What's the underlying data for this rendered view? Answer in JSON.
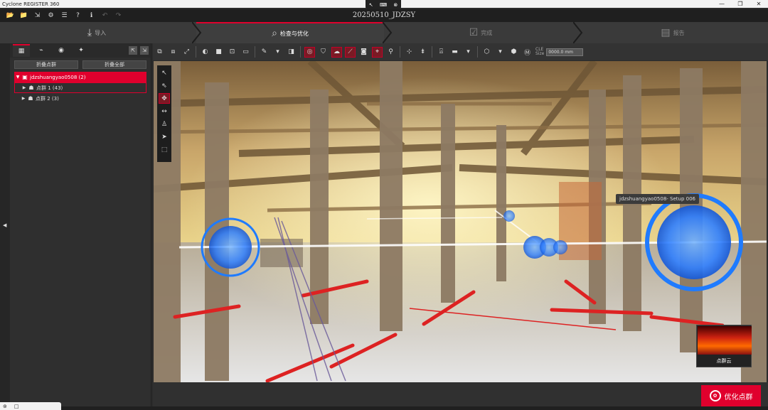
{
  "titlebar": {
    "app_title": "Cyclone REGISTER 360",
    "remote_icons": [
      "pointer-icon",
      "keyboard-icon",
      "close-circle-icon"
    ],
    "win_minimize": "—",
    "win_maximize": "❐",
    "win_close": "✕"
  },
  "menu": {
    "project_title": "20250510_JDZSY",
    "quick_actions": [
      {
        "name": "open-folder-icon",
        "glyph": "📂",
        "enabled": true
      },
      {
        "name": "import-folder-icon",
        "glyph": "📁",
        "enabled": true
      },
      {
        "name": "export-icon",
        "glyph": "⇲",
        "enabled": true
      },
      {
        "name": "settings-icon",
        "glyph": "⚙",
        "enabled": true
      },
      {
        "name": "database-icon",
        "glyph": "☰",
        "enabled": true
      },
      {
        "name": "help-icon",
        "glyph": "?",
        "enabled": true
      },
      {
        "name": "info-icon",
        "glyph": "ℹ",
        "enabled": true
      },
      {
        "name": "undo-icon",
        "glyph": "↶",
        "enabled": false
      },
      {
        "name": "redo-icon",
        "glyph": "↷",
        "enabled": false
      }
    ]
  },
  "workflow": {
    "steps": [
      {
        "label": "导入",
        "icon": "⤓",
        "icon_name": "import-icon",
        "state": "normal"
      },
      {
        "label": "检查与优化",
        "icon": "⌕",
        "icon_name": "review-optimize-icon",
        "state": "active"
      },
      {
        "label": "完成",
        "icon": "☑",
        "icon_name": "finalize-icon",
        "state": "dim"
      },
      {
        "label": "报告",
        "icon": "▤",
        "icon_name": "report-icon",
        "state": "dim"
      }
    ]
  },
  "left_panel": {
    "tabs": [
      "project-tree-icon",
      "link-icon",
      "globe-icon",
      "bundle-icon"
    ],
    "right_tabs": [
      "export-tab-icon",
      "import-tab-icon"
    ],
    "collapse_bundles": "折叠点群",
    "collapse_all": "折叠全部",
    "tree": {
      "project": "jdzshuangyao0508 (2)",
      "groups": [
        {
          "label": "点群 1 (43)",
          "outlined": true
        },
        {
          "label": "点群 2 (3)",
          "outlined": false
        }
      ]
    }
  },
  "viewport_toolbar": {
    "cle_label_line1": "CLE",
    "cle_label_line2": "Size",
    "cle_value": "0000.0 mm"
  },
  "viewport": {
    "tooltip": "jdzshuangyao0508- Setup 006",
    "thumbnail_label": "点群云"
  },
  "optimize_button": {
    "label": "优化点群"
  },
  "colors": {
    "accent": "#e0002d",
    "setup_blue": "#1f7bff",
    "dark_bg": "#2b2b2b"
  }
}
